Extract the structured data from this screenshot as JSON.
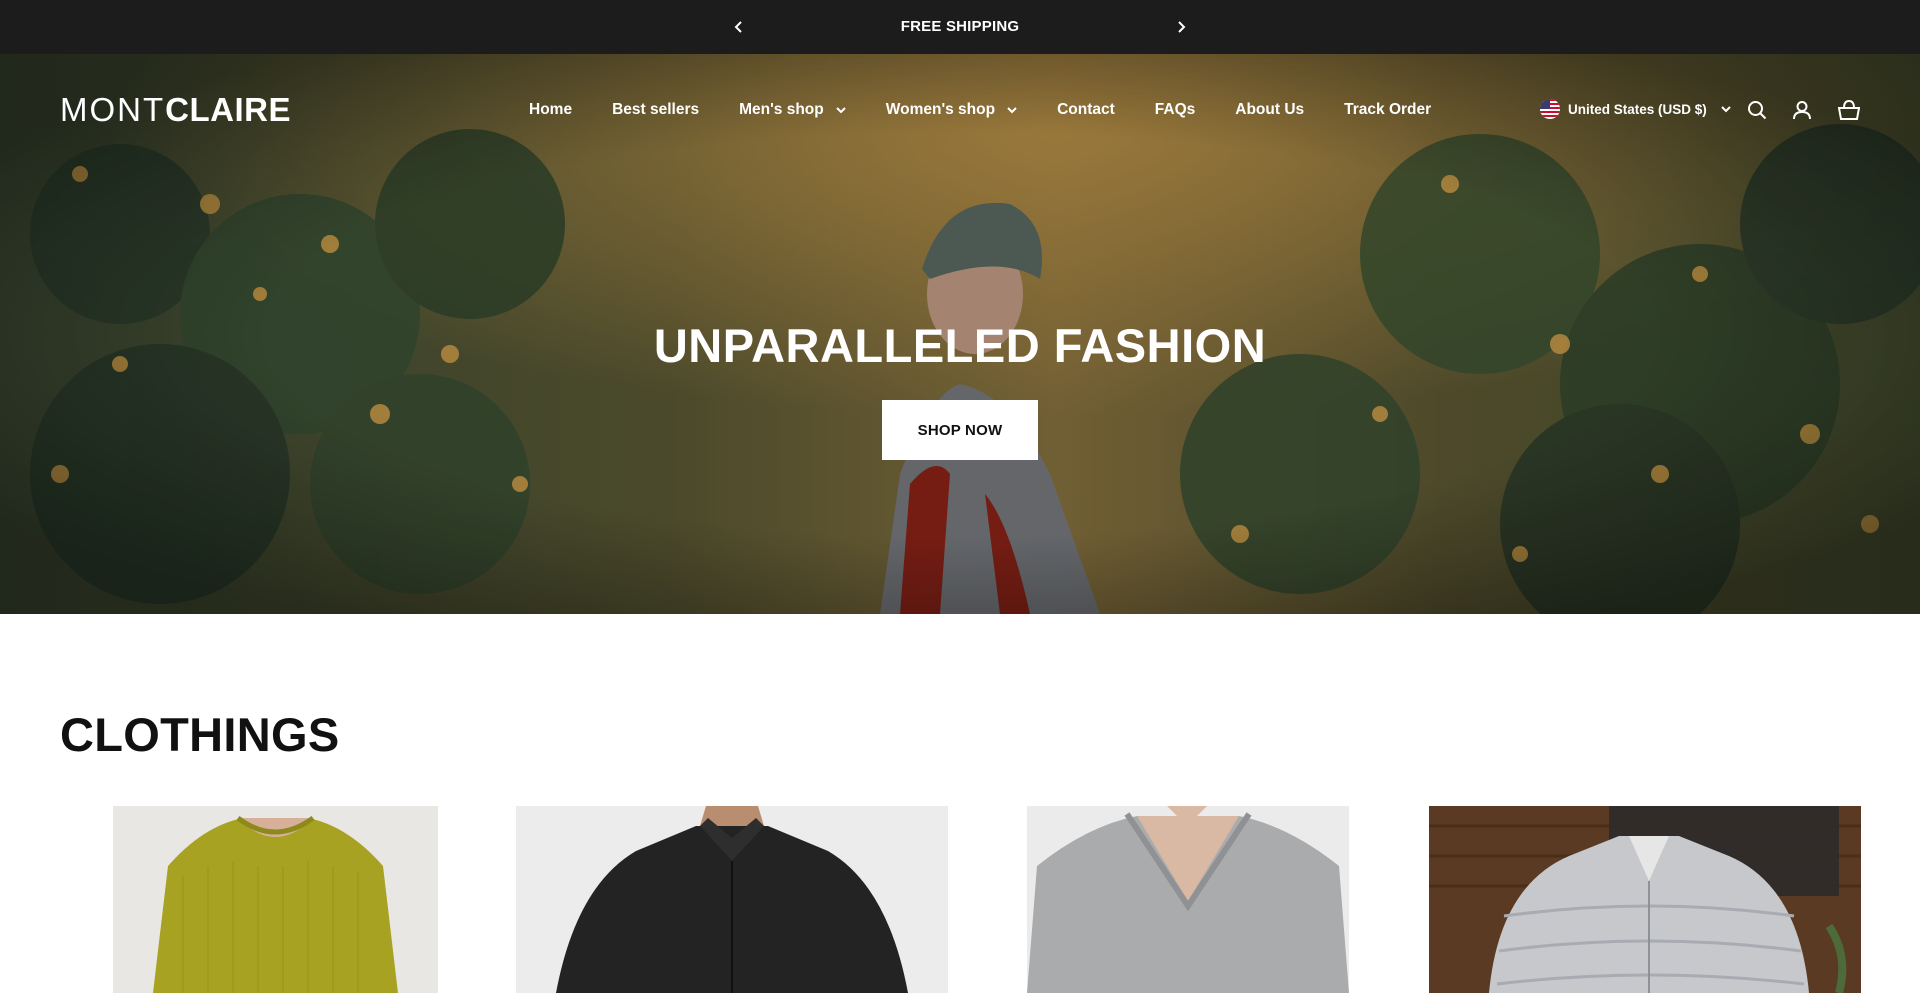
{
  "announcement": {
    "message": "FREE SHIPPING",
    "prev_icon": "chevron-left-icon",
    "next_icon": "chevron-right-icon"
  },
  "header": {
    "logo_light": "MONT",
    "logo_bold": "CLAIRE",
    "nav": [
      {
        "label": "Home"
      },
      {
        "label": "Best sellers"
      },
      {
        "label": "Men's shop",
        "dropdown": true
      },
      {
        "label": "Women's shop",
        "dropdown": true
      },
      {
        "label": "Contact"
      },
      {
        "label": "FAQs"
      },
      {
        "label": "About Us"
      },
      {
        "label": "Track Order"
      }
    ],
    "locale": "United States (USD $)",
    "icons": [
      "us-flag-icon",
      "search-icon",
      "account-icon",
      "cart-icon"
    ]
  },
  "hero": {
    "title": "UNPARALLELED FASHION",
    "button": "SHOP NOW"
  },
  "section": {
    "title": "CLOTHINGS",
    "products": [
      {
        "image": "yellow knit sweater"
      },
      {
        "image": "black dress shirt"
      },
      {
        "image": "grey v-neck blouse"
      },
      {
        "image": "grey puffer jacket"
      }
    ]
  },
  "colors": {
    "announcement_bg": "#1c1c1c",
    "text_dark": "#111111",
    "white": "#ffffff"
  }
}
